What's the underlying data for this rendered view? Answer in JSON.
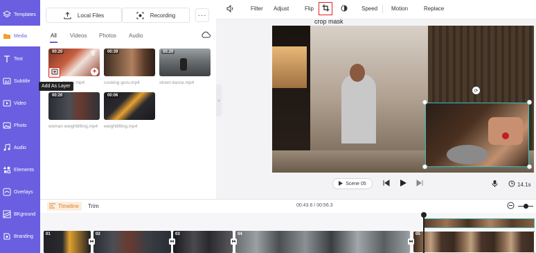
{
  "sidebar": {
    "items": [
      {
        "label": "Templates",
        "icon": "layers-icon"
      },
      {
        "label": "Media",
        "icon": "folder-icon"
      },
      {
        "label": "Text",
        "icon": "text-icon"
      },
      {
        "label": "Subtitle",
        "icon": "subtitle-icon"
      },
      {
        "label": "Video",
        "icon": "video-icon"
      },
      {
        "label": "Photo",
        "icon": "photo-icon"
      },
      {
        "label": "Audio",
        "icon": "music-icon"
      },
      {
        "label": "Elements",
        "icon": "elements-icon"
      },
      {
        "label": "Overlays",
        "icon": "overlays-icon"
      },
      {
        "label": "BKground",
        "icon": "background-icon"
      },
      {
        "label": "Branding",
        "icon": "branding-icon"
      }
    ],
    "active": "Media"
  },
  "media": {
    "local_files": "Local Files",
    "recording": "Recording",
    "more": "···",
    "tabs": [
      "All",
      "Videos",
      "Photos",
      "Audio"
    ],
    "items": [
      {
        "duration": "00:20",
        "filename": "dance.mp4"
      },
      {
        "duration": "00:39",
        "filename": "cooking guru.mp4"
      },
      {
        "duration": "00:20",
        "filename": "street dance.mp4"
      },
      {
        "duration": "00:20",
        "filename": "woman weightlifting.mp4"
      },
      {
        "duration": "00:06",
        "filename": "weightlifting.mp4"
      }
    ],
    "tooltip": "Add As Layer"
  },
  "toolbar": {
    "filter": "Filter",
    "adjust": "Adjust",
    "flip": "Flip",
    "speed": "Speed",
    "motion": "Motion",
    "replace": "Replace",
    "crop_caption": "crop mask"
  },
  "playback": {
    "scene": "Scene 05",
    "duration": "14.1s"
  },
  "timeline": {
    "timeline_tab": "Timeline",
    "trim_tab": "Trim",
    "time": "00:43.6 / 00:56.3",
    "clips": [
      "01",
      "02",
      "03",
      "04",
      "05"
    ]
  },
  "colors": {
    "accent": "#6a5fe0",
    "highlight": "#e02020",
    "selection": "#2ec4c4",
    "timeline_active": "#e07a20"
  }
}
